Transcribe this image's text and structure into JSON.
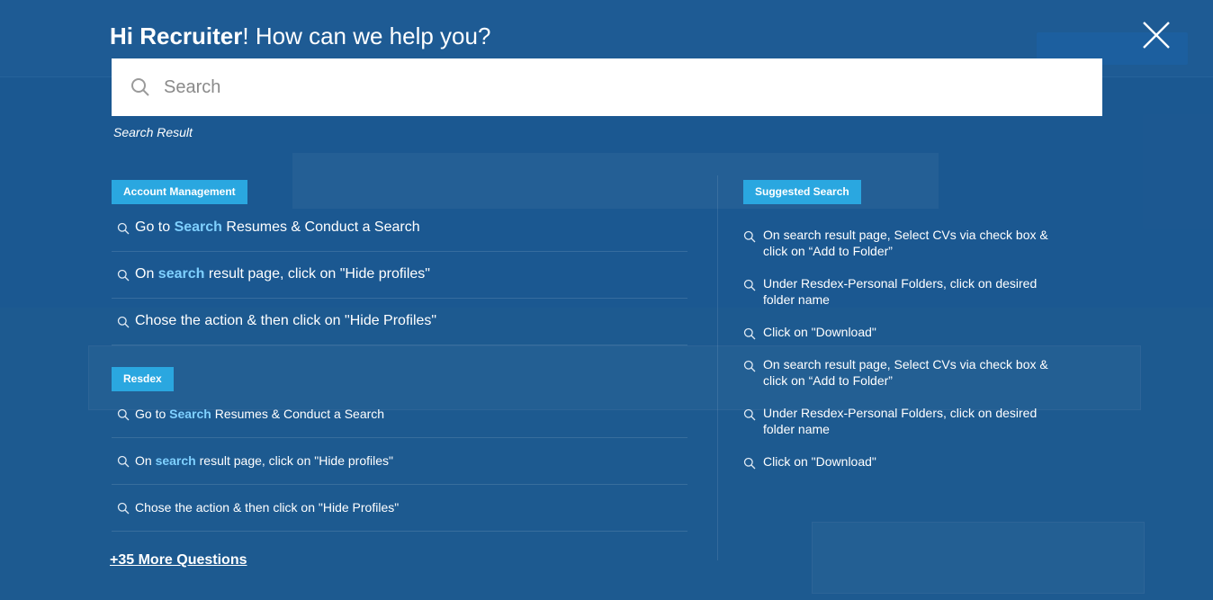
{
  "modal": {
    "greeting_name": "Hi Recruiter",
    "greeting_rest": "! How can we help you?",
    "close_icon": "close-icon"
  },
  "search": {
    "placeholder": "Search",
    "value": "",
    "icon": "search-icon"
  },
  "result_label": "Search Result",
  "account_management": {
    "label": "Account Management",
    "items": [
      {
        "pre": "Go to ",
        "hl": "Search",
        "post": " Resumes & Conduct a Search"
      },
      {
        "pre": "On ",
        "hl": "search",
        "post": " result page, click on \"Hide profiles\""
      },
      {
        "pre": "Chose the action & then click on \"Hide Profiles\"",
        "hl": "",
        "post": ""
      }
    ]
  },
  "resdex": {
    "label": "Resdex",
    "items": [
      {
        "pre": "Go to ",
        "hl": "Search",
        "post": " Resumes & Conduct a Search"
      },
      {
        "pre": "On ",
        "hl": "search",
        "post": " result page, click on \"Hide profiles\""
      },
      {
        "pre": "Chose the action & then click on \"Hide Profiles\"",
        "hl": "",
        "post": ""
      }
    ]
  },
  "suggested_search": {
    "label": "Suggested Search",
    "items": [
      "On search result page, Select CVs via check box & click on “Add to Folder”",
      "Under Resdex-Personal Folders, click on desired folder name",
      "Click on \"Download\"",
      "On search result page, Select CVs via check box & click on “Add to Folder”",
      "Under Resdex-Personal Folders, click on desired folder name",
      "Click on \"Download\""
    ]
  },
  "more_questions": "+35 More Questions",
  "colors": {
    "overlay": "#1f5e95",
    "badge": "#2aa7e0",
    "highlight": "#7fd0ff"
  }
}
